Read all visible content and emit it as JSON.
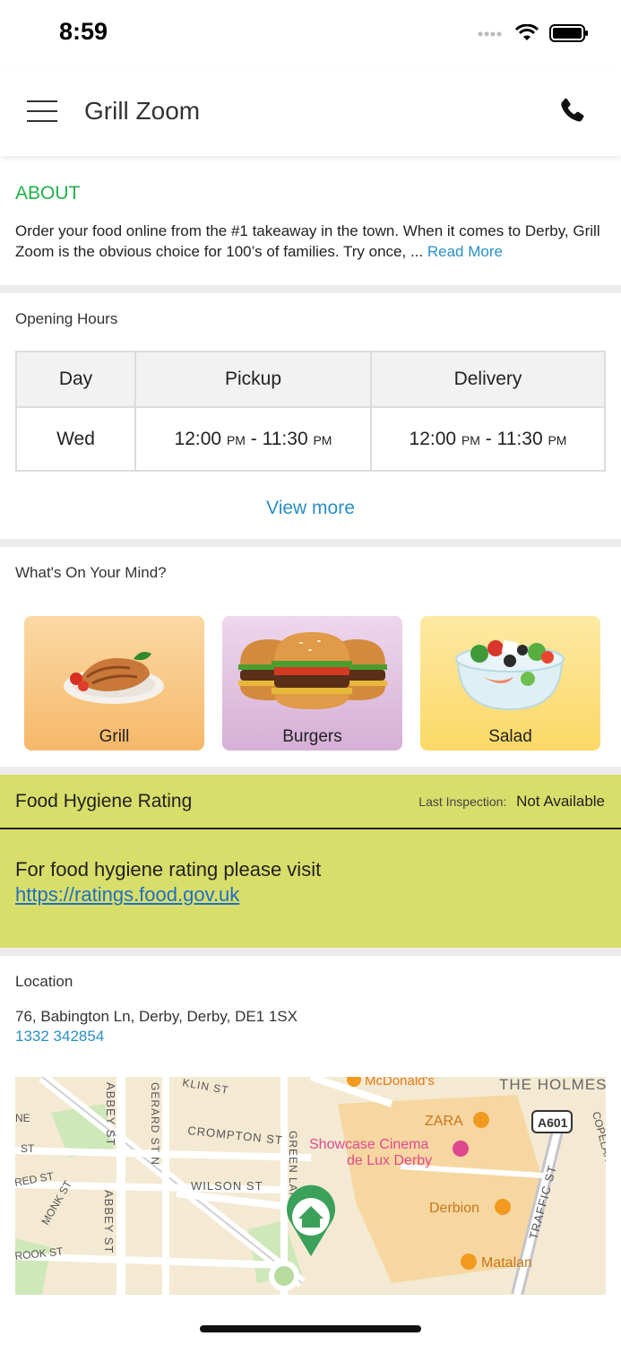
{
  "status_bar": {
    "time": "8:59"
  },
  "header": {
    "title": "Grill Zoom"
  },
  "about": {
    "heading": "ABOUT",
    "text": "Order your food online from the #1 takeaway in the town. When it comes to Derby, Grill Zoom is the obvious choice for 100’s of families. Try once, ...",
    "read_more": "Read More"
  },
  "opening_hours": {
    "label": "Opening Hours",
    "columns": [
      "Day",
      "Pickup",
      "Delivery"
    ],
    "row": {
      "day": "Wed",
      "pickup_start": "12:00",
      "pickup_start_ampm": "PM",
      "pickup_end": "11:30",
      "pickup_end_ampm": "PM",
      "delivery_start": "12:00",
      "delivery_start_ampm": "PM",
      "delivery_end": "11:30",
      "delivery_end_ampm": "PM",
      "separator": "-"
    },
    "view_more": "View more"
  },
  "categories": {
    "label": "What's On Your Mind?",
    "items": [
      {
        "label": "Grill",
        "color_top": "#fbd9a4",
        "color_bottom": "#f6b86a"
      },
      {
        "label": "Burgers",
        "color_top": "#eed7ec",
        "color_bottom": "#d6afd6"
      },
      {
        "label": "Salad",
        "color_top": "#fde9a3",
        "color_bottom": "#fbd866"
      }
    ]
  },
  "hygiene": {
    "title": "Food Hygiene Rating",
    "inspection_label": "Last Inspection:",
    "inspection_value": "Not Available",
    "text": "For food hygiene rating please visit",
    "link": "https://ratings.food.gov.uk",
    "background": "#d8de6a"
  },
  "location": {
    "label": "Location",
    "address": "76, Babington Ln, Derby, Derby, DE1 1SX",
    "phone": "1332 342854",
    "map": {
      "labels": {
        "mcdonalds": "McDonald's",
        "the_holmes": "THE HOLMES",
        "zara": "ZARA",
        "a601": "A601",
        "abbey_st": "ABBEY ST",
        "gerard_st": "GERARD ST N",
        "crompton_st": "CROMPTON ST",
        "green_lane": "GREEN LANE",
        "showcase": "Showcase Cinema",
        "showcase2": "de Lux Derby",
        "wilson_st": "WILSON ST",
        "monk_st": "MONK ST",
        "derbion": "Derbion",
        "traffic_st": "TRAFFIC ST",
        "matalan": "Matalan",
        "brook_st": "ROOK ST",
        "abbey_st2": "ABBEY ST",
        "red_st": "RED ST",
        "st": "ST",
        "ne": "NE",
        "lin_st": "KLIN ST",
        "copeland": "COPELAN"
      }
    }
  },
  "colors": {
    "accent_green": "#21b14b",
    "link_blue": "#2a8fc6"
  }
}
